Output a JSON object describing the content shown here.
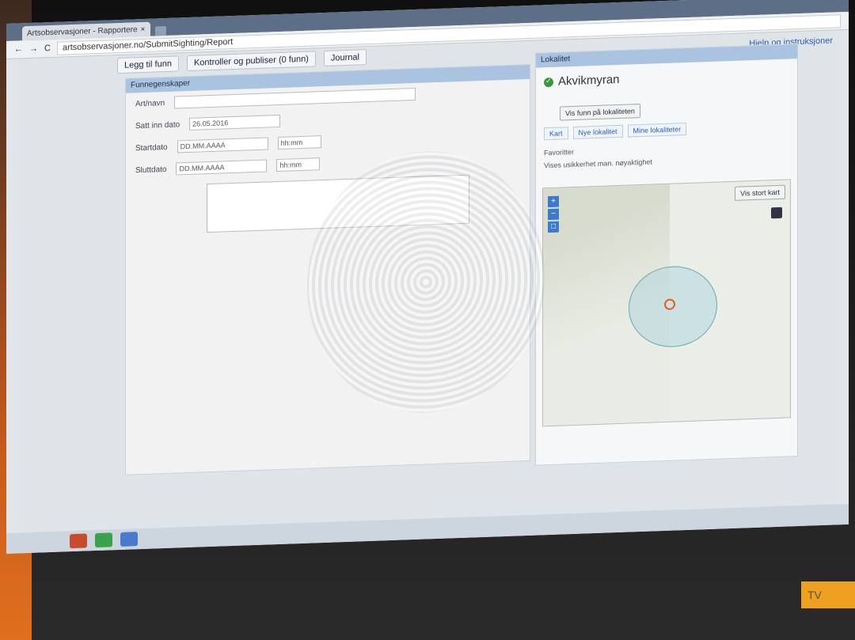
{
  "browser": {
    "tab_title": "Artsobservasjoner - Rapportere",
    "url": "artsobservasjoner.no/SubmitSighting/Report"
  },
  "app_tabs": {
    "tab1": "Legg til funn",
    "tab2": "Kontroller og publiser (0 funn)",
    "tab3": "Journal",
    "help": "Hjelp og instruksjoner"
  },
  "form": {
    "header": "Funnegenskaper",
    "species_label": "Art/navn",
    "date_label": "Satt inn dato",
    "start_label": "Startdato",
    "end_label": "Sluttdato",
    "date_value": "26.05.2016",
    "date_placeholder": "DD.MM.AAAA",
    "time1": "hh:mm",
    "time2": "hh:mm"
  },
  "location": {
    "header": "Lokalitet",
    "name": "Akvikmyran",
    "button_label": "Vis funn på lokaliteten",
    "subtabs": [
      "Kart",
      "Nye lokalitet",
      "Mine lokaliteter"
    ],
    "field1": "Favoritter",
    "field2": "Vises usikkerhet man. nøyaktighet",
    "map_button": "Vis stort kart"
  },
  "corner_text": "TV"
}
